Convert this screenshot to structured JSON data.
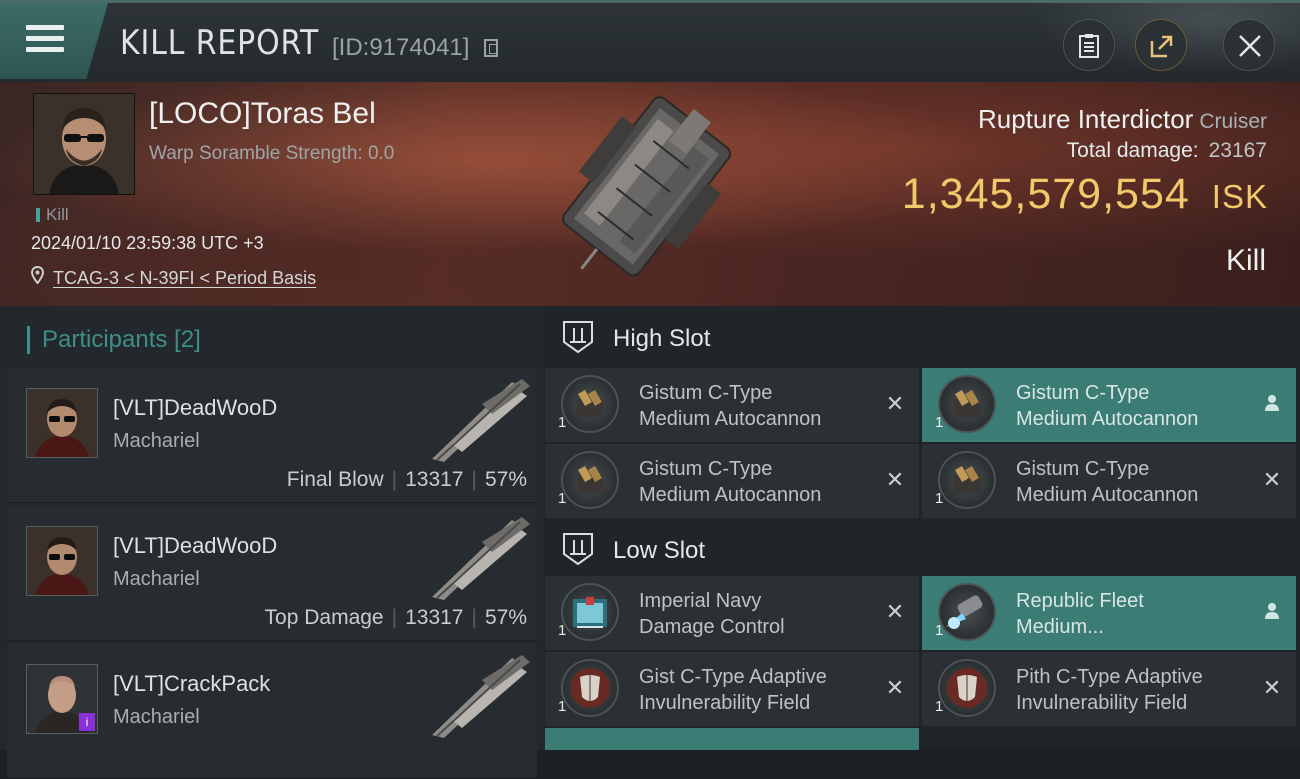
{
  "header": {
    "title": "KILL REPORT",
    "id_label": "[ID:9174041]",
    "icons": {
      "menu": "hamburger-icon",
      "copy": "copy-icon",
      "report": "clipboard-icon",
      "share": "share-icon",
      "close": "close-icon"
    }
  },
  "victim": {
    "name": "[LOCO]Toras Bel",
    "scramble": "Warp Soramble Strength: 0.0",
    "kill_tag": "Kill",
    "time": "2024/01/10 23:59:38 UTC +3",
    "location": "TCAG-3 < N-39FI < Period Basis",
    "ship_name": "Rupture Interdictor",
    "ship_class": "Cruiser",
    "total_damage_label": "Total damage:",
    "total_damage": "23167",
    "isk_value": "1,345,579,554",
    "isk_unit": "ISK",
    "result": "Kill"
  },
  "participants": {
    "title": "Participants [2]",
    "items": [
      {
        "name": "[VLT]DeadWooD",
        "ship": "Machariel",
        "role": "Final Blow",
        "damage": "13317",
        "percent": "57%"
      },
      {
        "name": "[VLT]DeadWooD",
        "ship": "Machariel",
        "role": "Top Damage",
        "damage": "13317",
        "percent": "57%"
      },
      {
        "name": "[VLT]CrackPack",
        "ship": "Machariel",
        "badge": "i"
      }
    ]
  },
  "slots": {
    "high": {
      "title": "High Slot",
      "modules": [
        {
          "name_line1": "Gistum C-Type",
          "name_line2": "Medium Autocannon",
          "qty": "1",
          "status": "×",
          "fitted": false
        },
        {
          "name_line1": "Gistum C-Type",
          "name_line2": "Medium Autocannon",
          "qty": "1",
          "status": "person-icon",
          "fitted": true
        },
        {
          "name_line1": "Gistum C-Type",
          "name_line2": "Medium Autocannon",
          "qty": "1",
          "status": "×",
          "fitted": false
        },
        {
          "name_line1": "Gistum C-Type",
          "name_line2": "Medium Autocannon",
          "qty": "1",
          "status": "×",
          "fitted": false
        }
      ]
    },
    "low": {
      "title": "Low Slot",
      "modules": [
        {
          "name_line1": "Imperial Navy",
          "name_line2": "Damage Control",
          "qty": "1",
          "status": "×",
          "fitted": false
        },
        {
          "name_line1": "Republic Fleet",
          "name_line2": "Medium...",
          "qty": "1",
          "status": "person-icon",
          "fitted": true
        },
        {
          "name_line1": "Gist C-Type Adaptive",
          "name_line2": "Invulnerability Field",
          "qty": "1",
          "status": "×",
          "fitted": false
        },
        {
          "name_line1": "Pith C-Type Adaptive",
          "name_line2": "Invulnerability Field",
          "qty": "1",
          "status": "×",
          "fitted": false
        }
      ]
    }
  },
  "colors": {
    "accent": "#3f8e87",
    "isk": "#f2c86a",
    "fitted_bg": "#3b7c75"
  }
}
